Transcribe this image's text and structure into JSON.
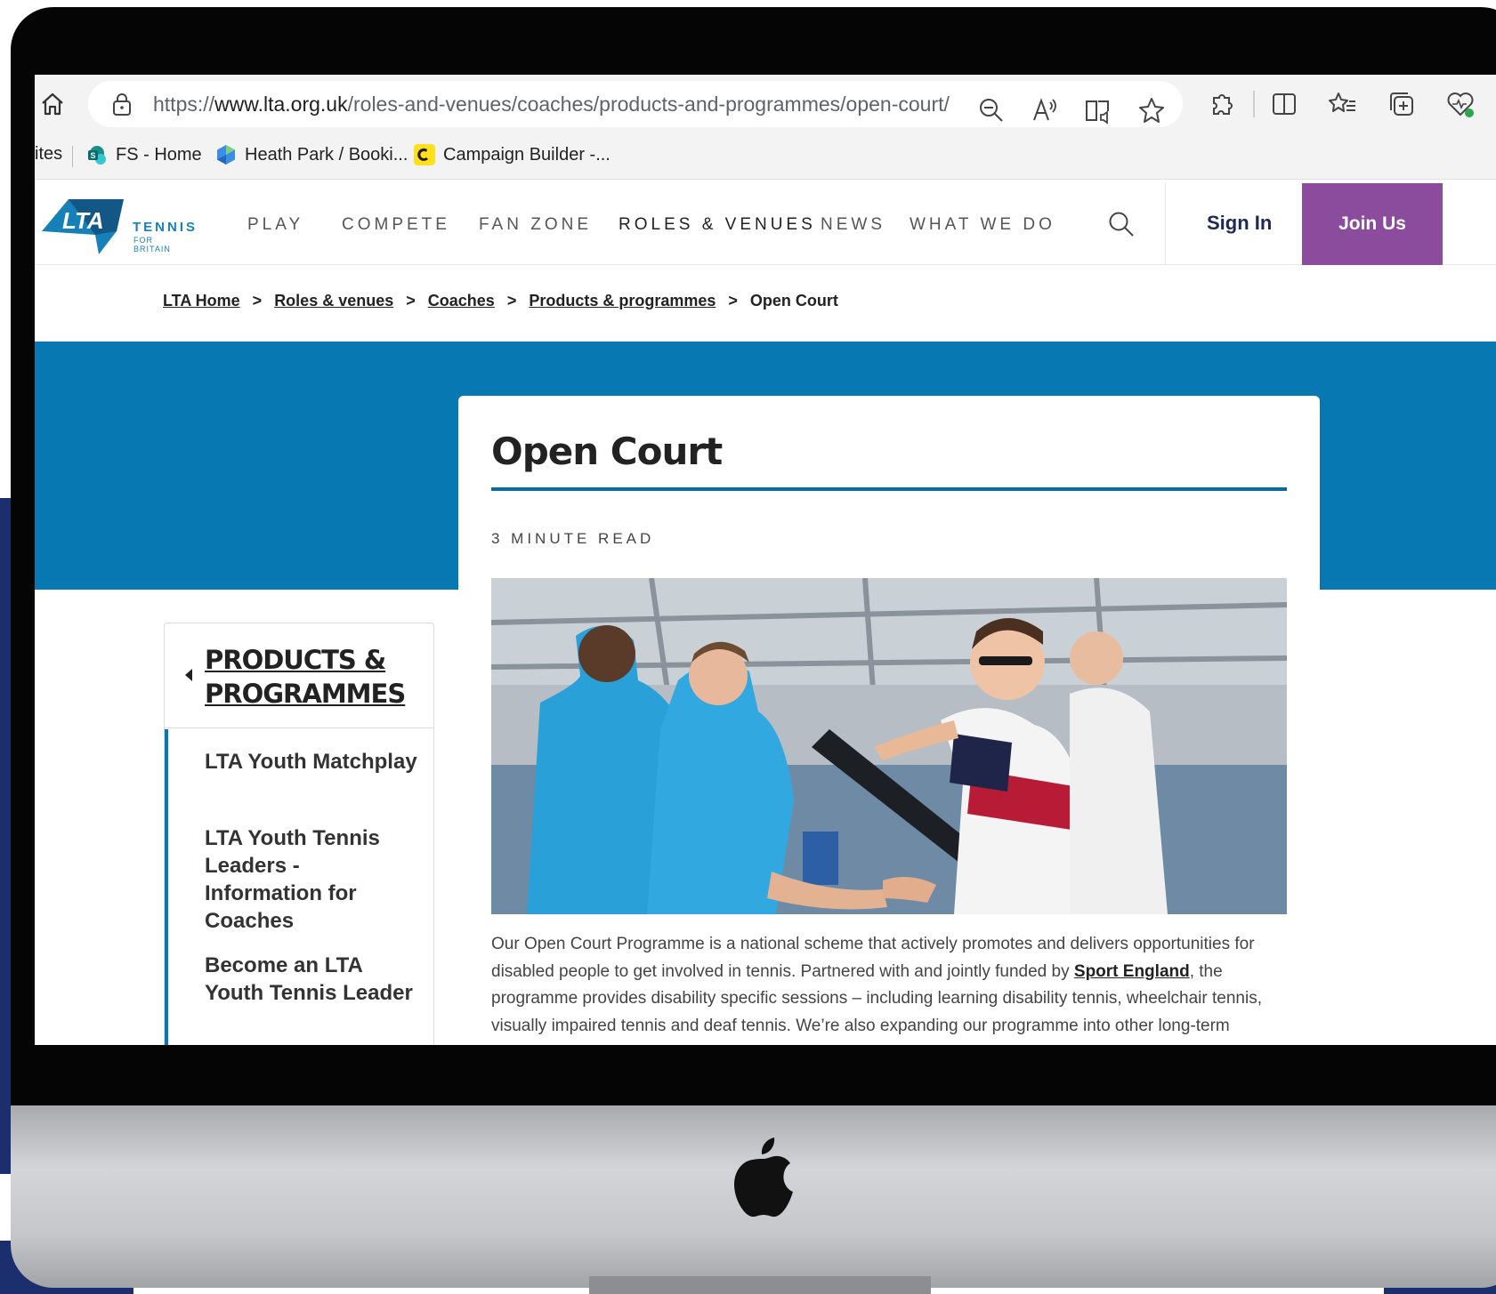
{
  "browser": {
    "url_prefix": "https://",
    "url_domain": "www.lta.org.uk",
    "url_path": "/roles-and-venues/coaches/products-and-programmes/open-court/",
    "bookmarks": [
      {
        "label": "ites",
        "icon": "none"
      },
      {
        "label": "FS - Home",
        "icon": "sharepoint-icon"
      },
      {
        "label": "Heath Park / Booki...",
        "icon": "hexagon-icon"
      },
      {
        "label": "Campaign Builder -...",
        "icon": "mailchimp-icon"
      }
    ]
  },
  "site": {
    "logo": {
      "text": "LTA",
      "tennis": "TENNIS",
      "sub": "FOR BRITAIN"
    },
    "nav": [
      "PLAY",
      "COMPETE",
      "FAN ZONE",
      "ROLES & VENUES",
      "NEWS",
      "WHAT WE DO"
    ],
    "sign_in": "Sign In",
    "join_us": "Join Us",
    "brand_colors": {
      "blue": "#0878b2",
      "purple": "#8c4c9d",
      "navy": "#1e2a55"
    }
  },
  "breadcrumb": {
    "items": [
      "LTA Home",
      "Roles & venues",
      "Coaches",
      "Products & programmes",
      "Open Court"
    ],
    "separator": ">"
  },
  "sidebar": {
    "title": "PRODUCTS & PROGRAMMES",
    "items": [
      "LTA Youth Matchplay",
      "LTA Youth Tennis Leaders - Information for Coaches",
      "Become an LTA Youth Tennis Leader"
    ]
  },
  "article": {
    "title": "Open Court",
    "read_time": "3 MINUTE READ",
    "body_before_link": "Our Open Court Programme is a national scheme that actively promotes and delivers opportunities for disabled people to get involved in tennis. Partnered with and jointly funded by ",
    "body_link": "Sport England",
    "body_after_link": ", the programme provides disability specific sessions – including learning disability tennis, wheelchair tennis, visually impaired tennis and deaf tennis. We’re also expanding our programme into other long-term"
  }
}
